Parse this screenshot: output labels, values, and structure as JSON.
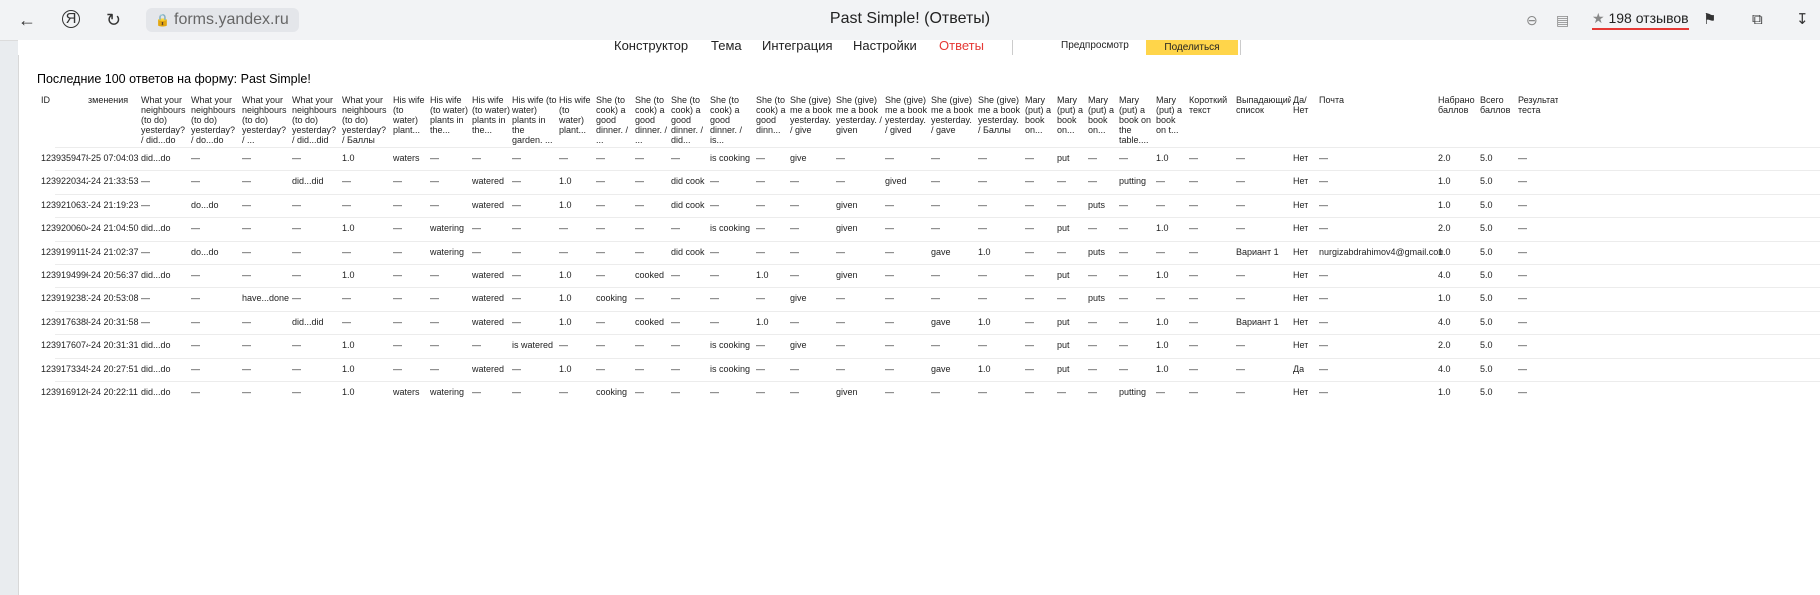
{
  "browser": {
    "url": "forms.yandex.ru",
    "title": "Past Simple! (Ответы)",
    "reviews": "198 отзывов"
  },
  "nav": {
    "items": [
      "Конструктор",
      "Тема",
      "Интеграция",
      "Настройки",
      "Ответы"
    ],
    "active_index": 4,
    "preview": "Предпросмотр",
    "share": "Поделиться"
  },
  "panel": {
    "title": "Последние 100 ответов на форму: Past Simple!"
  },
  "table": {
    "headers": [
      "ID",
      "зменения",
      "What your neighbours (to do) yesterday? / did...do",
      "What your neighbours (to do) yesterday? / do...do",
      "What your neighbours (to do) yesterday? / ...",
      "What your neighbours (to do) yesterday? / did...did",
      "What your neighbours (to do) yesterday? / Баллы",
      "His wife (to water) plant...",
      "His wife (to water) plants in the...",
      "His wife (to water) plants in the...",
      "His wife (to water) plants in the garden. ...",
      "His wife (to water) plant...",
      "She (to cook) a good dinner. / ...",
      "She (to cook) a good dinner. / ...",
      "She (to cook) a good dinner. / did...",
      "She (to cook) a good dinner. / is...",
      "She (to cook) a good dinn...",
      "She (give) me a book yesterday. / give",
      "She (give) me a book yesterday. / given",
      "She (give) me a book yesterday. / gived",
      "She (give) me a book yesterday. / gave",
      "She (give) me a book yesterday. / Баллы",
      "Mary (put) a book on...",
      "Mary (put) a book on...",
      "Mary (put) a book on...",
      "Mary (put) a book on the table....",
      "Mary (put) a book on t...",
      "Короткий текст",
      "Выпадающий список",
      "Да/ Нет",
      "Почта",
      "Набрано баллов",
      "Всего баллов",
      "Результат теста"
    ],
    "rows": [
      [
        "1239359478",
        "-25 07:04:03",
        "did...do",
        "—",
        "—",
        "—",
        "1.0",
        "waters",
        "—",
        "—",
        "—",
        "—",
        "—",
        "—",
        "—",
        "is cooking",
        "—",
        "give",
        "—",
        "—",
        "—",
        "—",
        "—",
        "put",
        "—",
        "—",
        "1.0",
        "—",
        "—",
        "Нет",
        "—",
        "2.0",
        "5.0",
        "—"
      ],
      [
        "1239220342",
        "-24 21:33:53",
        "—",
        "—",
        "—",
        "did...did",
        "—",
        "—",
        "—",
        "watered",
        "—",
        "1.0",
        "—",
        "—",
        "did cook",
        "—",
        "—",
        "—",
        "—",
        "gived",
        "—",
        "—",
        "—",
        "—",
        "—",
        "putting",
        "—",
        "—",
        "—",
        "Нет",
        "—",
        "1.0",
        "5.0",
        "—"
      ],
      [
        "1239210631",
        "-24 21:19:23",
        "—",
        "do...do",
        "—",
        "—",
        "—",
        "—",
        "—",
        "watered",
        "—",
        "1.0",
        "—",
        "—",
        "did cook",
        "—",
        "—",
        "—",
        "given",
        "—",
        "—",
        "—",
        "—",
        "—",
        "puts",
        "—",
        "—",
        "—",
        "—",
        "Нет",
        "—",
        "1.0",
        "5.0",
        "—"
      ],
      [
        "1239200604",
        "-24 21:04:50",
        "did...do",
        "—",
        "—",
        "—",
        "1.0",
        "—",
        "watering",
        "—",
        "—",
        "—",
        "—",
        "—",
        "—",
        "is cooking",
        "—",
        "—",
        "given",
        "—",
        "—",
        "—",
        "—",
        "put",
        "—",
        "—",
        "1.0",
        "—",
        "—",
        "Нет",
        "—",
        "2.0",
        "5.0",
        "—"
      ],
      [
        "1239199115",
        "-24 21:02:37",
        "—",
        "do...do",
        "—",
        "—",
        "—",
        "—",
        "watering",
        "—",
        "—",
        "—",
        "—",
        "—",
        "did cook",
        "—",
        "—",
        "—",
        "—",
        "—",
        "gave",
        "1.0",
        "—",
        "—",
        "puts",
        "—",
        "—",
        "—",
        "Вариант 1",
        "Нет",
        "nurgizabdrahimov4@gmail.com",
        "1.0",
        "5.0",
        "—"
      ],
      [
        "1239194996",
        "-24 20:56:37",
        "did...do",
        "—",
        "—",
        "—",
        "1.0",
        "—",
        "—",
        "watered",
        "—",
        "1.0",
        "—",
        "cooked",
        "—",
        "—",
        "1.0",
        "—",
        "given",
        "—",
        "—",
        "—",
        "—",
        "put",
        "—",
        "—",
        "1.0",
        "—",
        "—",
        "Нет",
        "—",
        "4.0",
        "5.0",
        "—"
      ],
      [
        "1239192381",
        "-24 20:53:08",
        "—",
        "—",
        "have...done",
        "—",
        "—",
        "—",
        "—",
        "watered",
        "—",
        "1.0",
        "cooking",
        "—",
        "—",
        "—",
        "—",
        "give",
        "—",
        "—",
        "—",
        "—",
        "—",
        "—",
        "puts",
        "—",
        "—",
        "—",
        "—",
        "Нет",
        "—",
        "1.0",
        "5.0",
        "—"
      ],
      [
        "1239176388",
        "-24 20:31:58",
        "—",
        "—",
        "—",
        "did...did",
        "—",
        "—",
        "—",
        "watered",
        "—",
        "1.0",
        "—",
        "cooked",
        "—",
        "—",
        "1.0",
        "—",
        "—",
        "—",
        "gave",
        "1.0",
        "—",
        "put",
        "—",
        "—",
        "1.0",
        "—",
        "Вариант 1",
        "Нет",
        "—",
        "4.0",
        "5.0",
        "—"
      ],
      [
        "1239176074",
        "-24 20:31:31",
        "did...do",
        "—",
        "—",
        "—",
        "1.0",
        "—",
        "—",
        "—",
        "is watered",
        "—",
        "—",
        "—",
        "—",
        "is cooking",
        "—",
        "give",
        "—",
        "—",
        "—",
        "—",
        "—",
        "put",
        "—",
        "—",
        "1.0",
        "—",
        "—",
        "Нет",
        "—",
        "2.0",
        "5.0",
        "—"
      ],
      [
        "1239173345",
        "-24 20:27:51",
        "did...do",
        "—",
        "—",
        "—",
        "1.0",
        "—",
        "—",
        "watered",
        "—",
        "1.0",
        "—",
        "—",
        "—",
        "is cooking",
        "—",
        "—",
        "—",
        "—",
        "gave",
        "1.0",
        "—",
        "put",
        "—",
        "—",
        "1.0",
        "—",
        "—",
        "Да",
        "—",
        "4.0",
        "5.0",
        "—"
      ],
      [
        "1239169126",
        "-24 20:22:11",
        "did...do",
        "—",
        "—",
        "—",
        "1.0",
        "waters",
        "watering",
        "—",
        "—",
        "—",
        "cooking",
        "—",
        "—",
        "—",
        "—",
        "—",
        "given",
        "—",
        "—",
        "—",
        "—",
        "—",
        "—",
        "putting",
        "—",
        "—",
        "—",
        "Нет",
        "—",
        "1.0",
        "5.0",
        "—"
      ]
    ]
  }
}
